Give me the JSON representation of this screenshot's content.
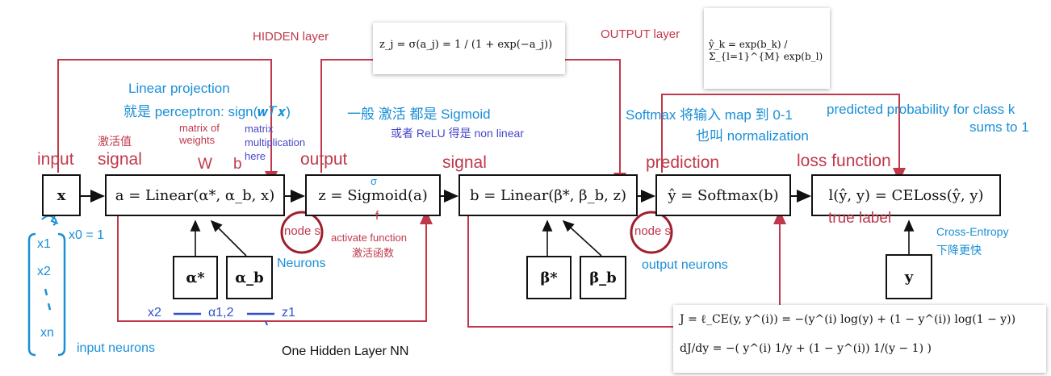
{
  "colors": {
    "red": "#c0394b",
    "blue": "#1a8fd6",
    "purple": "#4848c8",
    "line": "#111111"
  },
  "boxes": {
    "x": "x",
    "linear_a": "a = Linear(α*, α_b, x)",
    "sigmoid": "z = Sigmoid(a)",
    "linear_b": "b = Linear(β*, β_b, z)",
    "softmax": "ŷ = Softmax(b)",
    "loss": "l(ŷ, y) = CELoss(ŷ, y)",
    "alpha_star": "α*",
    "alpha_b": "α_b",
    "beta_star": "β*",
    "beta_b": "β_b",
    "y": "y"
  },
  "stage_labels": {
    "input": "input",
    "signal1": "signal",
    "output": "output",
    "signal2": "signal",
    "prediction": "prediction",
    "loss_function": "loss function"
  },
  "annotations": {
    "hidden_layer": "HIDDEN layer",
    "output_layer": "OUTPUT layer",
    "linear_projection": "Linear projection",
    "perceptron": "就是 perceptron: sign(𝒘𝑇𝒙)",
    "activation_value": "激活值",
    "matrix_of_weights": "matrix of weights",
    "matrix_multiplication": "matrix multiplication here",
    "W": "W",
    "b": "b",
    "sigmoid_general": "一般 激活 都是 Sigmoid",
    "relu": "或者 ReLU 得是 non linear",
    "sigma": "σ",
    "f": "f",
    "node1": "node s",
    "activate_function": "activate function",
    "activate_function_cn": "激活函数",
    "neurons": "Neurons",
    "softmax_note": "Softmax 将输入 map 到 0-1",
    "normalization": "也叫 normalization",
    "predicted_probability": "predicted probability for class k",
    "sums_to_1": "sums to 1",
    "node2": "node s",
    "output_neurons": "output neurons",
    "true_label": "true label",
    "cross_entropy": "Cross-Entropy",
    "cross_entropy_cn": "下降更快",
    "title": "One Hidden Layer NN"
  },
  "handwritten": {
    "x0": "x0 = 1",
    "x1": "x1",
    "x2": "x2",
    "xn": "xn",
    "input_neurons": "input neurons",
    "bottom_x2": "x2",
    "alpha12": "α1,2",
    "z1": "z1"
  },
  "formulas": {
    "z_eq": "z_j = σ(a_j) = 1 / (1 + exp(−a_j))",
    "yhat_eq": "ŷ_k = exp(b_k) / Σ_{l=1}^{M} exp(b_l)",
    "j_eq": "J = ℓ_CE(y, y^(i)) = −(y^(i) log(y) + (1 − y^(i)) log(1 − y))",
    "djdy_eq": "dJ/dy = −( y^(i) 1/y + (1 − y^(i)) 1/(y − 1) )"
  }
}
